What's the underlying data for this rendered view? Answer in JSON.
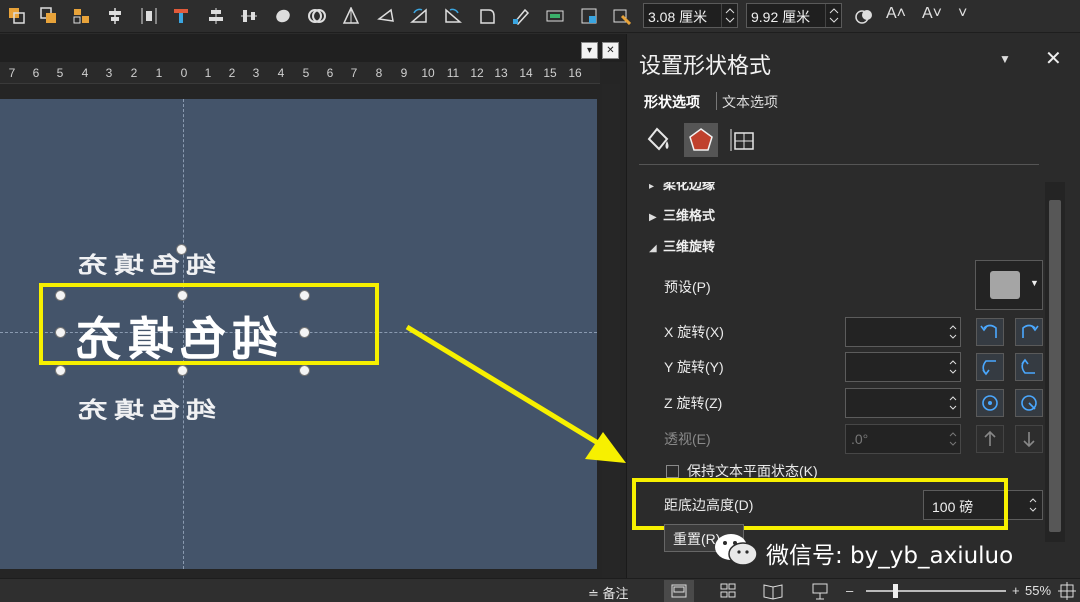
{
  "toolbar": {
    "icons": [
      "bring-forward-icon",
      "send-backward-icon",
      "selection-pane-icon",
      "align-icon",
      "distribute-icon",
      "text-effects-icon",
      "align-middle-icon",
      "distribute-vertical-icon",
      "merge-shapes-icon",
      "combine-icon",
      "triangle-icon",
      "edit-points-icon",
      "rotate-icon",
      "freeform-icon",
      "shape-style-icon",
      "group-icon",
      "crop-icon",
      "size-icon"
    ],
    "height_value": "3.08 厘米",
    "width_value": "9.92 厘米",
    "lock_icon": "lock-ratio-icon",
    "increase_font": "A˄",
    "decrease_font": "A˅",
    "overflow": "˅"
  },
  "ruler": {
    "ticks": [
      "7",
      "6",
      "5",
      "4",
      "3",
      "2",
      "1",
      "0",
      "1",
      "2",
      "3",
      "4",
      "5",
      "6",
      "7",
      "8",
      "9",
      "10",
      "11",
      "12",
      "13",
      "14",
      "15",
      "16"
    ]
  },
  "canvas": {
    "wordart_text": "纯色填充"
  },
  "pane": {
    "title": "设置形状格式",
    "tab_shape": "形状选项",
    "tab_text": "文本选项",
    "section_soft_edges": "柔化边缘",
    "section_3d_format": "三维格式",
    "section_3d_rotation": "三维旋转",
    "preset_label": "预设(P)",
    "x_rotation_label": "X 旋转(X)",
    "y_rotation_label": "Y 旋转(Y)",
    "z_rotation_label": "Z 旋转(Z)",
    "perspective_label": "透视(E)",
    "perspective_value": ".0°",
    "keep_flat_label": "保持文本平面状态(K)",
    "depth_label": "距底边高度(D)",
    "depth_value": "100 磅",
    "reset_label": "重置(R)"
  },
  "watermark": {
    "text": "微信号: by_yb_axiuluo"
  },
  "statusbar": {
    "notes_label": "备注",
    "zoom_value": "55%",
    "zoom_minus": "–",
    "zoom_plus": "+"
  },
  "colors": {
    "canvas": "#44546a",
    "highlight": "#f7f000",
    "accent_icon": "#c0412d"
  }
}
